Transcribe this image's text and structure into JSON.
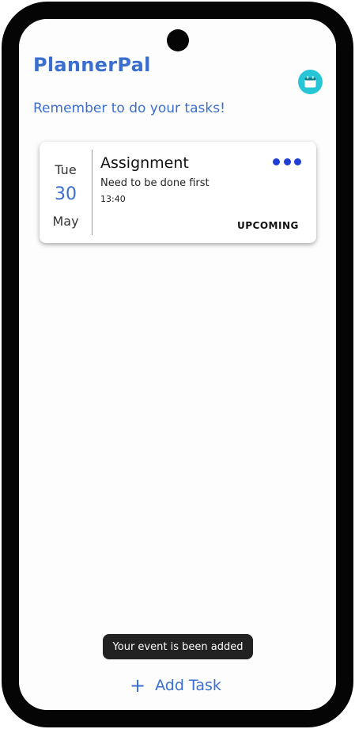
{
  "app": {
    "title": "PlannerPal",
    "reminder": "Remember to do your tasks!"
  },
  "header": {
    "calendar_icon": "calendar-icon"
  },
  "task": {
    "date_day": "Tue",
    "date_num": "30",
    "date_month": "May",
    "title": "Assignment",
    "description": "Need to be done first",
    "time": "13:40",
    "status": "UPCOMING",
    "more_icon": "more-dots-icon"
  },
  "toast": {
    "message": "Your event is been added"
  },
  "footer": {
    "add_icon": "plus-icon",
    "add_label": "Add Task"
  },
  "colors": {
    "brand": "#3a6ecf",
    "accent": "#27c6d6",
    "more_dots": "#1f3fd6"
  }
}
